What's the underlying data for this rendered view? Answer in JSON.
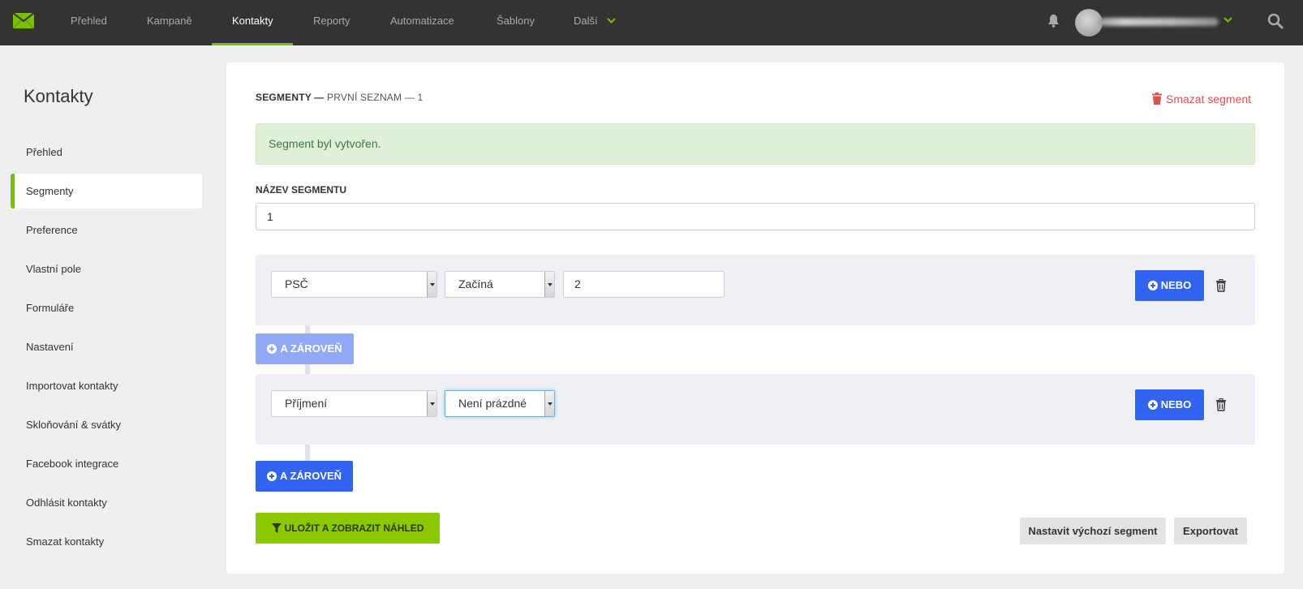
{
  "topnav": {
    "items": [
      "Přehled",
      "Kampaně",
      "Kontakty",
      "Reporty",
      "Automatizace",
      "Šablony",
      "Další"
    ],
    "active": "Kontakty",
    "accent_color": "#79c000",
    "icons": [
      "envelope-logo-icon",
      "chevron-down-icon",
      "bell-icon",
      "avatar",
      "search-icon"
    ]
  },
  "sidebar": {
    "title": "Kontakty",
    "items": [
      "Přehled",
      "Segmenty",
      "Preference",
      "Vlastní pole",
      "Formuláře",
      "Nastavení",
      "Importovat kontakty",
      "Skloňování & svátky",
      "Facebook integrace",
      "Odhlásit kontakty",
      "Smazat kontakty"
    ],
    "active": "Segmenty"
  },
  "main": {
    "crumb_strong": "SEGMENTY —",
    "crumb_rest": "PRVNÍ SEZNAM — 1",
    "delete_segment": "Smazat segment",
    "alert": "Segment byl vytvořen.",
    "name_label": "NÁZEV SEGMENTU",
    "name_value": "1",
    "rules": [
      {
        "field": "PSČ",
        "operator": "Začíná",
        "value": "2",
        "or_button": "NEBO"
      },
      {
        "field": "Příjmení",
        "operator": "Není prázdné",
        "or_button": "NEBO"
      }
    ],
    "and_button": "A ZÁROVEŇ",
    "save_button": "ULOŽIT A ZOBRAZIT NÁHLED",
    "default_button": "Nastavit výchozí segment",
    "export_button": "Exportovat"
  },
  "colors": {
    "primary_blue": "#3264f0",
    "save_green": "#8cc800",
    "danger": "#d9534f",
    "success_bg": "#dff0d8"
  }
}
